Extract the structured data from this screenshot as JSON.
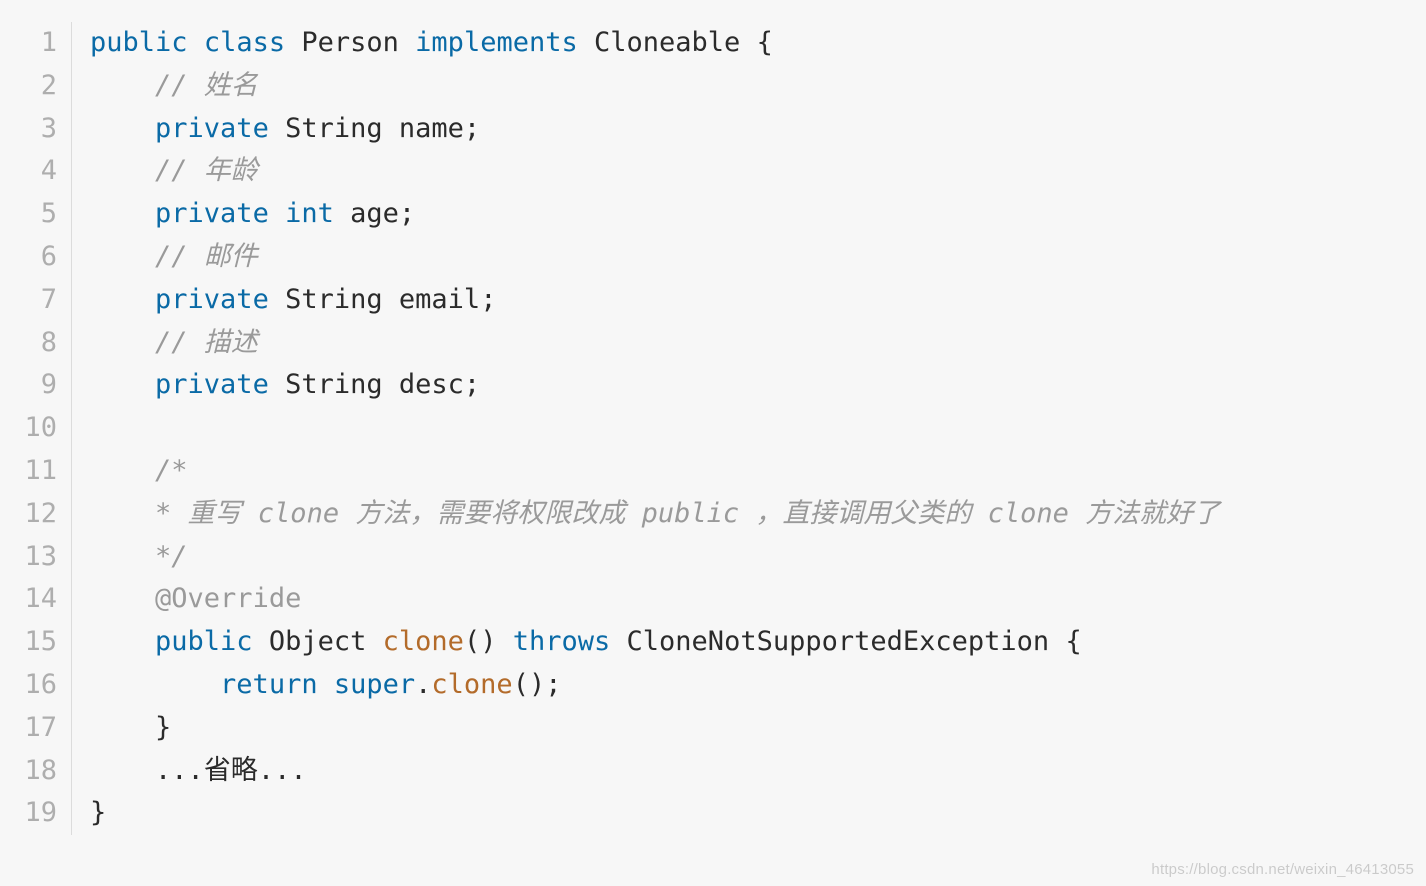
{
  "watermark": "https://blog.csdn.net/weixin_46413055",
  "lines": [
    {
      "num": "1",
      "tokens": [
        [
          "kw",
          "public"
        ],
        [
          "plain",
          " "
        ],
        [
          "kw",
          "class"
        ],
        [
          "plain",
          " "
        ],
        [
          "cls",
          "Person"
        ],
        [
          "plain",
          " "
        ],
        [
          "kw",
          "implements"
        ],
        [
          "plain",
          " "
        ],
        [
          "cls",
          "Cloneable"
        ],
        [
          "plain",
          " "
        ],
        [
          "pn",
          "{"
        ]
      ]
    },
    {
      "num": "2",
      "tokens": [
        [
          "plain",
          "    "
        ],
        [
          "cm",
          "// 姓名"
        ]
      ]
    },
    {
      "num": "3",
      "tokens": [
        [
          "plain",
          "    "
        ],
        [
          "kw",
          "private"
        ],
        [
          "plain",
          " "
        ],
        [
          "cls",
          "String"
        ],
        [
          "plain",
          " name"
        ],
        [
          "pn",
          ";"
        ]
      ]
    },
    {
      "num": "4",
      "tokens": [
        [
          "plain",
          "    "
        ],
        [
          "cm",
          "// 年龄"
        ]
      ]
    },
    {
      "num": "5",
      "tokens": [
        [
          "plain",
          "    "
        ],
        [
          "kw",
          "private"
        ],
        [
          "plain",
          " "
        ],
        [
          "kw",
          "int"
        ],
        [
          "plain",
          " age"
        ],
        [
          "pn",
          ";"
        ]
      ]
    },
    {
      "num": "6",
      "tokens": [
        [
          "plain",
          "    "
        ],
        [
          "cm",
          "// 邮件"
        ]
      ]
    },
    {
      "num": "7",
      "tokens": [
        [
          "plain",
          "    "
        ],
        [
          "kw",
          "private"
        ],
        [
          "plain",
          " "
        ],
        [
          "cls",
          "String"
        ],
        [
          "plain",
          " email"
        ],
        [
          "pn",
          ";"
        ]
      ]
    },
    {
      "num": "8",
      "tokens": [
        [
          "plain",
          "    "
        ],
        [
          "cm",
          "// 描述"
        ]
      ]
    },
    {
      "num": "9",
      "tokens": [
        [
          "plain",
          "    "
        ],
        [
          "kw",
          "private"
        ],
        [
          "plain",
          " "
        ],
        [
          "cls",
          "String"
        ],
        [
          "plain",
          " desc"
        ],
        [
          "pn",
          ";"
        ]
      ]
    },
    {
      "num": "10",
      "tokens": []
    },
    {
      "num": "11",
      "tokens": [
        [
          "plain",
          "    "
        ],
        [
          "cm",
          "/*"
        ]
      ]
    },
    {
      "num": "12",
      "tokens": [
        [
          "plain",
          "    "
        ],
        [
          "cm",
          "* 重写 clone 方法，需要将权限改成 public ，直接调用父类的 clone 方法就好了"
        ]
      ]
    },
    {
      "num": "13",
      "tokens": [
        [
          "plain",
          "    "
        ],
        [
          "cm",
          "*/"
        ]
      ]
    },
    {
      "num": "14",
      "tokens": [
        [
          "plain",
          "    "
        ],
        [
          "ann",
          "@Override"
        ]
      ]
    },
    {
      "num": "15",
      "tokens": [
        [
          "plain",
          "    "
        ],
        [
          "kw",
          "public"
        ],
        [
          "plain",
          " "
        ],
        [
          "cls",
          "Object"
        ],
        [
          "plain",
          " "
        ],
        [
          "fn",
          "clone"
        ],
        [
          "pn",
          "()"
        ],
        [
          "plain",
          " "
        ],
        [
          "kw",
          "throws"
        ],
        [
          "plain",
          " "
        ],
        [
          "cls",
          "CloneNotSupportedException"
        ],
        [
          "plain",
          " "
        ],
        [
          "pn",
          "{"
        ]
      ]
    },
    {
      "num": "16",
      "tokens": [
        [
          "plain",
          "        "
        ],
        [
          "kw",
          "return"
        ],
        [
          "plain",
          " "
        ],
        [
          "kw",
          "super"
        ],
        [
          "pn",
          "."
        ],
        [
          "fn",
          "clone"
        ],
        [
          "pn",
          "();"
        ]
      ]
    },
    {
      "num": "17",
      "tokens": [
        [
          "plain",
          "    "
        ],
        [
          "pn",
          "}"
        ]
      ]
    },
    {
      "num": "18",
      "tokens": [
        [
          "plain",
          "    "
        ],
        [
          "pn",
          "..."
        ],
        [
          "plain",
          "省略"
        ],
        [
          "pn",
          "..."
        ]
      ]
    },
    {
      "num": "19",
      "tokens": [
        [
          "pn",
          "}"
        ]
      ]
    }
  ]
}
